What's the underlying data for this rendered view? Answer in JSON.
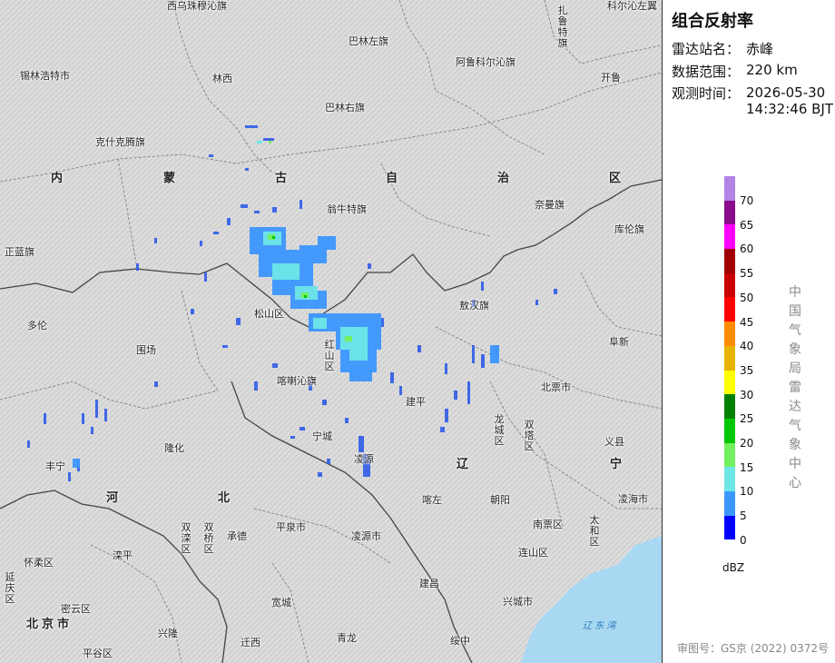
{
  "panel": {
    "title": "组合反射率",
    "station_label": "雷达站名：",
    "station_value": "赤峰",
    "range_label": "数据范围：",
    "range_value": "220 km",
    "time_label": "观测时间：",
    "time_date": "2026-05-30",
    "time_clock": "14:32:46 BJT",
    "legend_unit": "dBZ",
    "organization": "中国气象局雷达气象中心",
    "approval": "审图号：GS京 (2022) 0372号"
  },
  "legend": {
    "ticks": [
      "70",
      "65",
      "60",
      "55",
      "50",
      "45",
      "40",
      "35",
      "30",
      "25",
      "20",
      "15",
      "10",
      "5",
      "0"
    ],
    "colors": [
      "#b184e6",
      "#8b0c8b",
      "#ff00ff",
      "#a00000",
      "#c80000",
      "#ff0000",
      "#ff8c00",
      "#e6b400",
      "#ffff00",
      "#008200",
      "#00c800",
      "#73f05f",
      "#6ee6e6",
      "#3c96ff",
      "#0000ff"
    ]
  },
  "map": {
    "province_labels": [
      "内",
      "蒙",
      "古",
      "自",
      "治",
      "区",
      "河",
      "北",
      "辽",
      "宁"
    ],
    "places": [
      "西乌珠穆沁旗",
      "巴林左旗",
      "扎鲁特旗",
      "科尔沁左翼",
      "锡林浩特市",
      "林西",
      "阿鲁科尔沁旗",
      "开鲁",
      "巴林右旗",
      "克什克腾旗",
      "翁牛特旗",
      "奈曼旗",
      "正蓝旗",
      "库伦旗",
      "松山区",
      "敖汉旗",
      "多伦",
      "围场",
      "红山区",
      "阜新",
      "喀喇沁旗",
      "北票市",
      "建平",
      "隆化",
      "宁城",
      "凌源",
      "龙城区",
      "双塔区",
      "义县",
      "丰宁",
      "喀左",
      "朝阳",
      "凌海市",
      "平泉市",
      "双滦区",
      "双桥区",
      "承德",
      "南票区",
      "太和区",
      "怀柔区",
      "滦平",
      "凌源市",
      "连山区",
      "延庆区",
      "密云区",
      "宽城",
      "建昌",
      "兴城市",
      "北京市",
      "兴隆",
      "迁西",
      "青龙",
      "绥中",
      "平谷区"
    ],
    "sea_label": "辽 东 湾",
    "colors": {
      "terrain": "#dcdcdc",
      "sea": "#a9d8f2",
      "boundary": "#777777",
      "province_boundary": "#444444"
    }
  }
}
